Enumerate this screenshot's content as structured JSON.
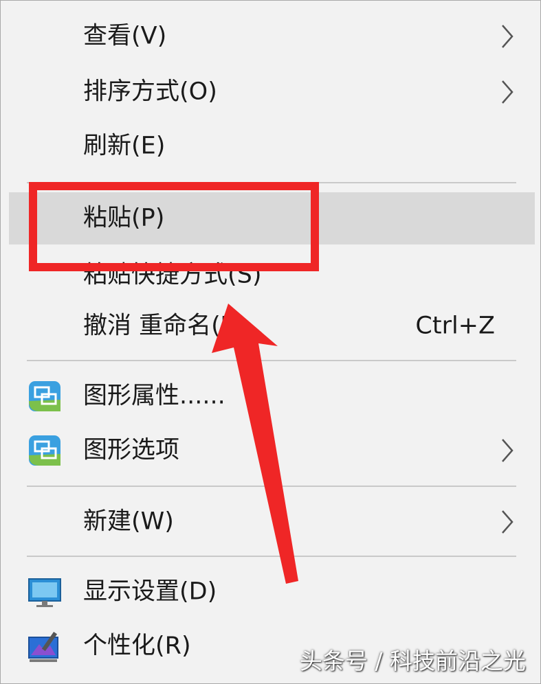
{
  "menu": {
    "items": [
      {
        "label": "查看(V)",
        "submenu": true
      },
      {
        "label": "排序方式(O)",
        "submenu": true
      },
      {
        "label": "刷新(E)"
      },
      {
        "label": "粘贴(P)",
        "highlighted": true
      },
      {
        "label": "粘贴快捷方式(S)"
      },
      {
        "label": "撤消 重命名(U)",
        "shortcut": "Ctrl+Z"
      },
      {
        "label": "图形属性......",
        "icon": "graphics-properties-icon"
      },
      {
        "label": "图形选项",
        "icon": "graphics-options-icon",
        "submenu": true
      },
      {
        "label": "新建(W)",
        "submenu": true
      },
      {
        "label": "显示设置(D)",
        "icon": "display-settings-icon"
      },
      {
        "label": "个性化(R)",
        "icon": "personalize-icon"
      }
    ]
  },
  "annotation": {
    "color": "#ef2626"
  },
  "watermark": {
    "text": "头条号 / 科技前沿之光"
  },
  "colors": {
    "menu_bg": "#f2f2f2",
    "highlight_bg": "#d9d9d9",
    "separator": "#c9c9c9",
    "annotation_red": "#ef2626"
  }
}
